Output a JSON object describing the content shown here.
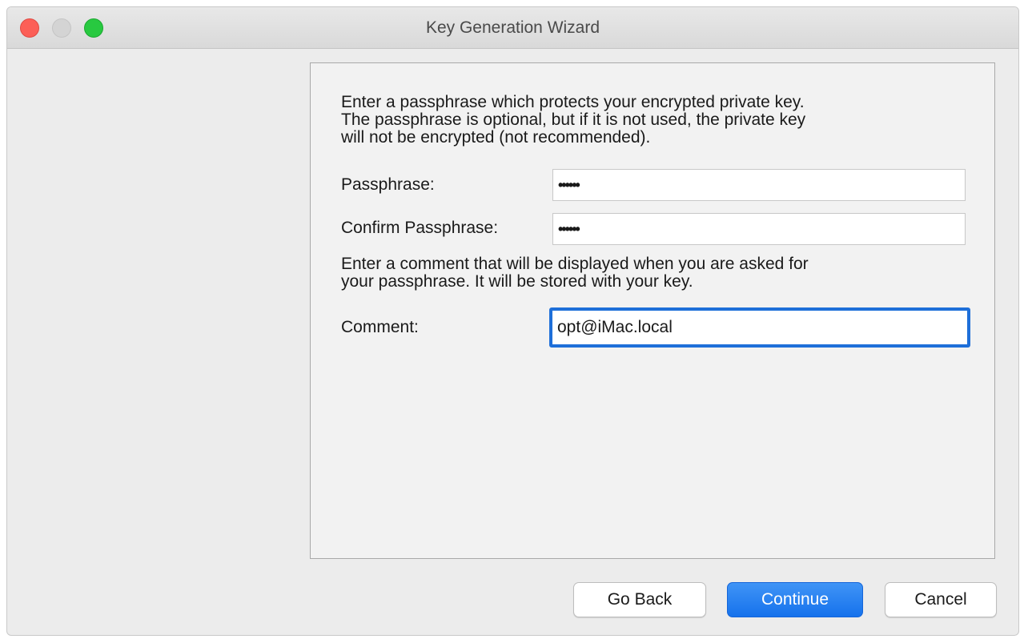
{
  "window": {
    "title": "Key Generation Wizard"
  },
  "content": {
    "intro_text": "Enter a passphrase which protects your encrypted private key.\nThe passphrase is optional, but if it is not used, the private key\nwill not be encrypted (not recommended).",
    "passphrase_label": "Passphrase:",
    "passphrase_value": "••••••",
    "confirm_label": "Confirm Passphrase:",
    "confirm_value": "••••••",
    "comment_info_text": "Enter a comment that will be displayed when you are asked for\nyour passphrase. It will be stored with your key.",
    "comment_label": "Comment:",
    "comment_value": "opt@iMac.local"
  },
  "buttons": {
    "go_back": "Go Back",
    "continue": "Continue",
    "cancel": "Cancel"
  },
  "colors": {
    "accent": "#1e6fd9",
    "close": "#fc5f57",
    "zoom": "#28c940"
  }
}
